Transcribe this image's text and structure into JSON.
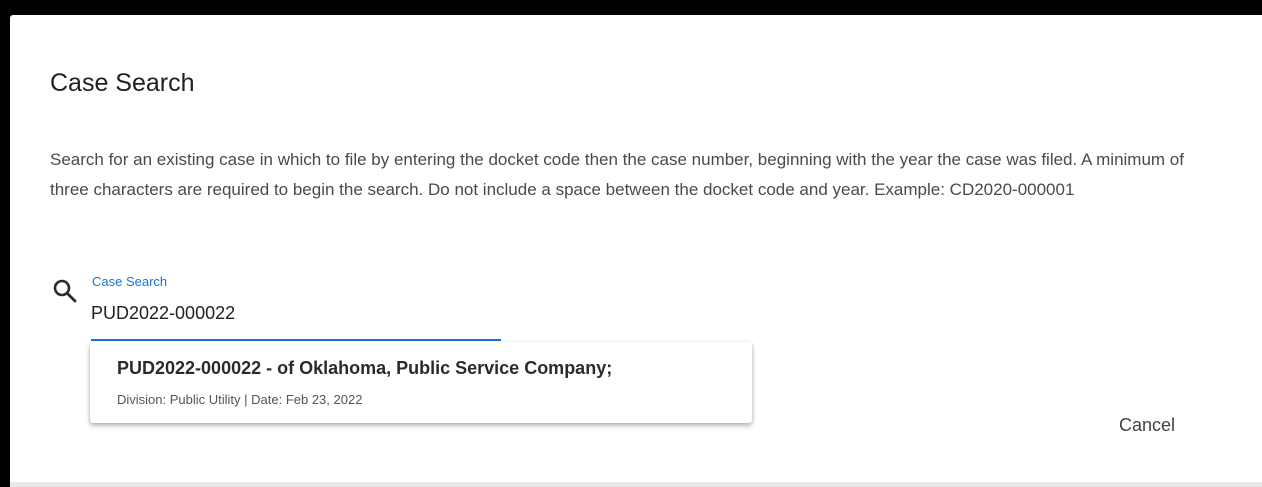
{
  "dialog": {
    "title": "Case Search",
    "description": "Search for an existing case in which to file by entering the docket code then the case number, beginning with the year the case was filed. A minimum of three characters are required to begin the search. Do not include a space between the docket code and year. Example: CD2020-000001"
  },
  "search": {
    "label": "Case Search",
    "value": "PUD2022-000022",
    "icon": "search-icon",
    "accent_color": "#1976d2"
  },
  "suggestions": [
    {
      "title": "PUD2022-000022 - of Oklahoma, Public Service Company;",
      "details": "Division: Public Utility | Date: Feb 23, 2022"
    }
  ],
  "actions": {
    "cancel_label": "Cancel"
  }
}
